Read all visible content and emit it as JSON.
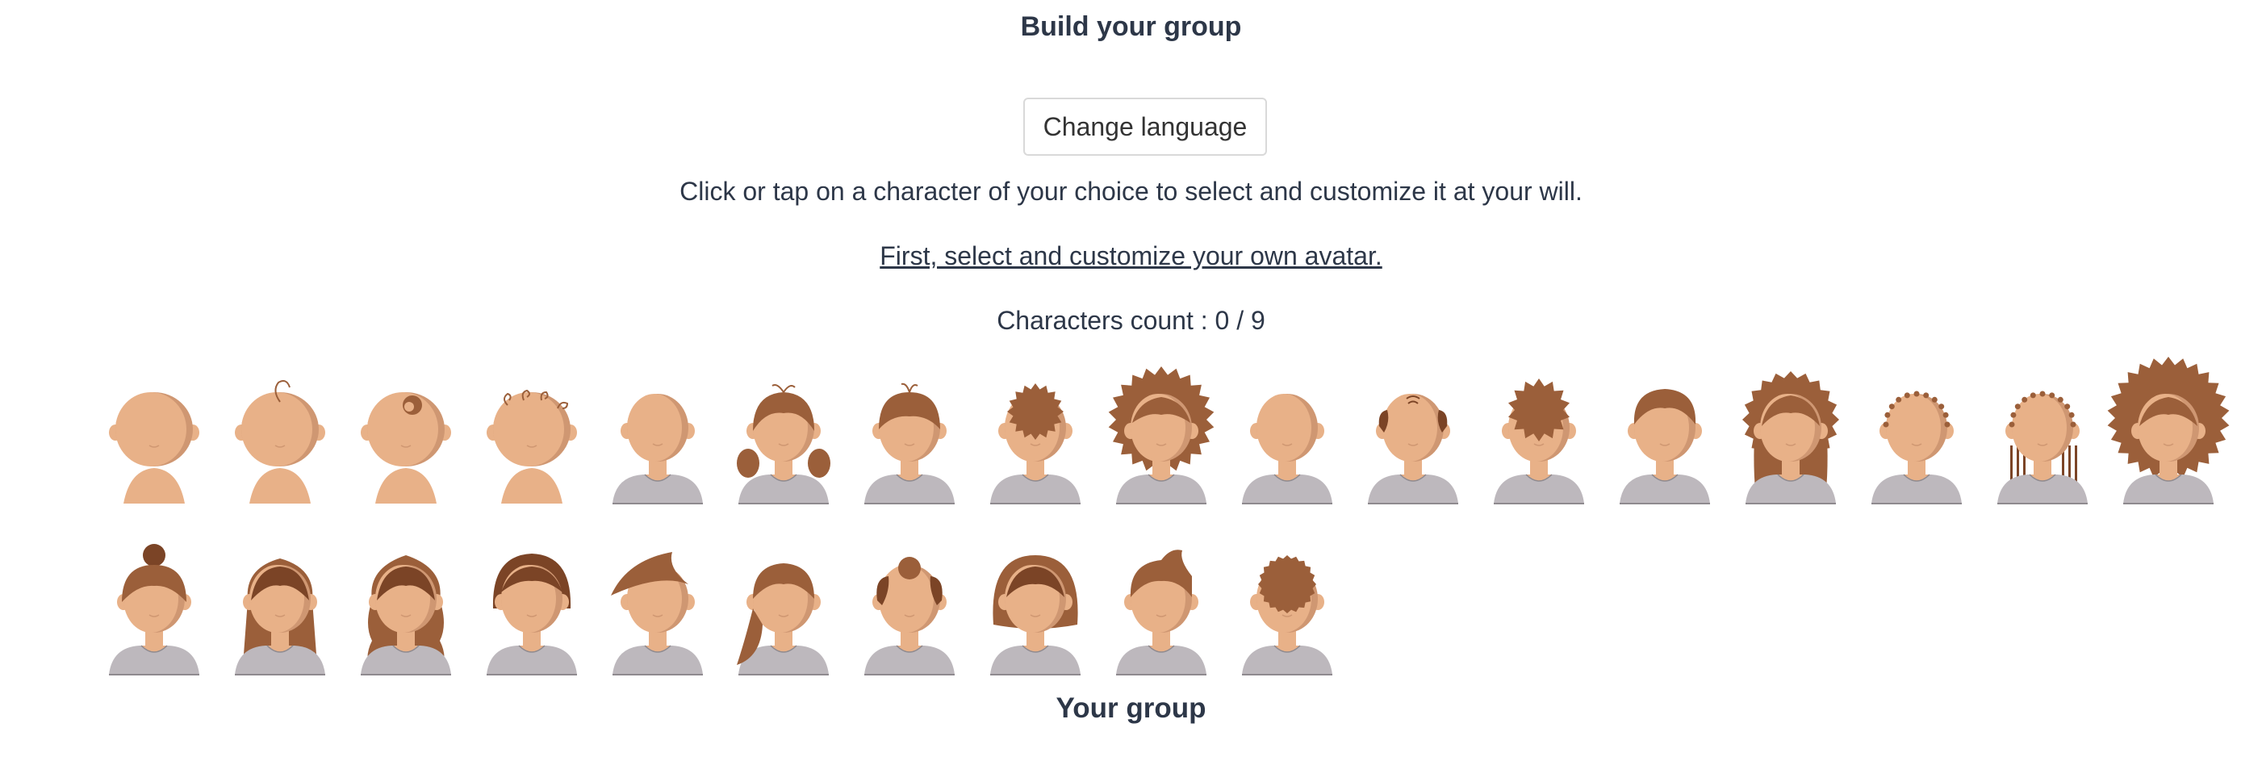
{
  "header": {
    "title": "Build your group"
  },
  "toolbar": {
    "change_language_label": "Change language"
  },
  "instructions": {
    "text": "Click or tap on a character of your choice to select and customize it at your will.",
    "first_step": "First, select and customize your own avatar."
  },
  "counter": {
    "text": "Characters count : 0 / 9",
    "selected": 0,
    "max": 9
  },
  "colors": {
    "skin": "#e8b188",
    "skin_shadow": "#cf9772",
    "hair": "#9b5f3a",
    "hair_dark": "#7b4426",
    "shirt": "#bdb8bd",
    "text": "#2d3748"
  },
  "avatars": [
    {
      "id": "baby-bald",
      "hair": "none",
      "body": "baby"
    },
    {
      "id": "baby-curl",
      "hair": "curl",
      "body": "baby"
    },
    {
      "id": "baby-bun",
      "hair": "bun-small",
      "body": "baby"
    },
    {
      "id": "baby-curls",
      "hair": "curls-many",
      "body": "baby"
    },
    {
      "id": "child-bald",
      "hair": "none",
      "body": "shirt"
    },
    {
      "id": "girl-pigtails",
      "hair": "pigtails",
      "body": "shirt"
    },
    {
      "id": "boy-tuft",
      "hair": "short-tuft",
      "body": "shirt"
    },
    {
      "id": "child-curly",
      "hair": "curly-short",
      "body": "shirt"
    },
    {
      "id": "girl-curly",
      "hair": "curly-big",
      "body": "shirt"
    },
    {
      "id": "teen-bald",
      "hair": "none",
      "body": "shirt"
    },
    {
      "id": "man-balding",
      "hair": "balding",
      "body": "shirt"
    },
    {
      "id": "boy-spiky",
      "hair": "spiky",
      "body": "shirt"
    },
    {
      "id": "boy-short",
      "hair": "short",
      "body": "shirt"
    },
    {
      "id": "girl-long-curly",
      "hair": "long-curly",
      "body": "shirt"
    },
    {
      "id": "man-buzz",
      "hair": "buzz-dots",
      "body": "shirt"
    },
    {
      "id": "woman-braids",
      "hair": "braids",
      "body": "shirt"
    },
    {
      "id": "woman-afro",
      "hair": "afro",
      "body": "shirt"
    },
    {
      "id": "woman-topknot",
      "hair": "topknot",
      "body": "shirt"
    },
    {
      "id": "woman-long",
      "hair": "long-straight",
      "body": "shirt"
    },
    {
      "id": "woman-long-wavy",
      "hair": "long-wavy",
      "body": "shirt"
    },
    {
      "id": "woman-bob",
      "hair": "bob",
      "body": "shirt"
    },
    {
      "id": "man-quiff",
      "hair": "quiff",
      "body": "shirt"
    },
    {
      "id": "woman-ponytail",
      "hair": "ponytail",
      "body": "shirt"
    },
    {
      "id": "woman-bun",
      "hair": "bun",
      "body": "shirt"
    },
    {
      "id": "woman-bob-wide",
      "hair": "bob-wide",
      "body": "shirt"
    },
    {
      "id": "boy-swept",
      "hair": "swept",
      "body": "shirt"
    },
    {
      "id": "man-curly-crop",
      "hair": "curly-crop",
      "body": "shirt"
    }
  ],
  "footer": {
    "group_title": "Your group"
  }
}
